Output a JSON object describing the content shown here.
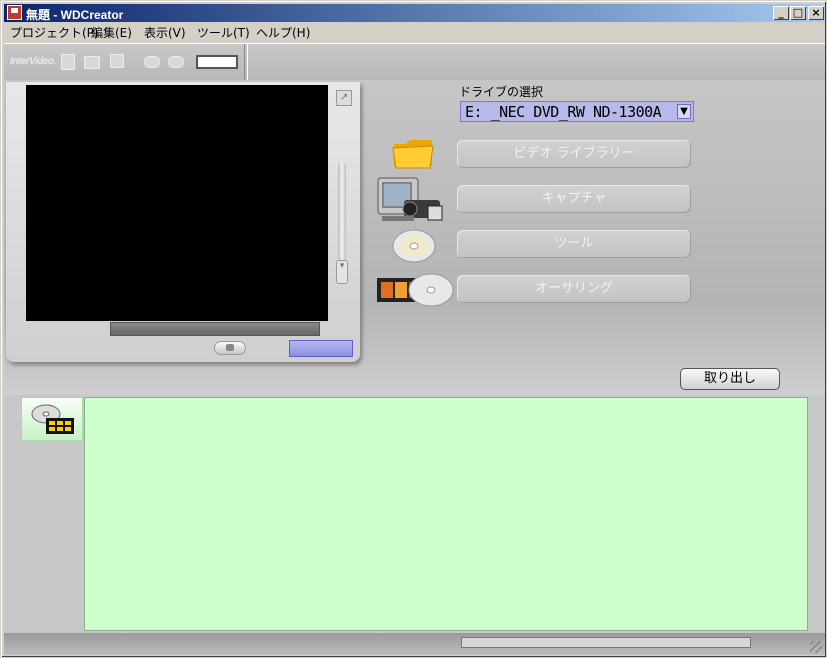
{
  "window": {
    "title": "無題 - WDCreator",
    "minimize": "_",
    "maximize": "□",
    "close": "×"
  },
  "menu": [
    {
      "label": "プロジェクト(P)"
    },
    {
      "label": "編集(E)"
    },
    {
      "label": "表示(V)"
    },
    {
      "label": "ツール(T)"
    },
    {
      "label": "ヘルプ(H)"
    }
  ],
  "toolbar": {
    "logo": "InterVideo."
  },
  "drive": {
    "label": "ドライブの選択",
    "selected": "E: _NEC DVD_RW ND-1300A",
    "arrow": "▼"
  },
  "buttons": {
    "video_library": "ビデオ ライブラリー",
    "capture": "キャプチャ",
    "tools": "ツール",
    "authoring": "オーサリング",
    "eject": "取り出し"
  },
  "colors": {
    "accent_panel": "#ccffcc",
    "title_start": "#0a246a",
    "title_end": "#a6caf0",
    "drive_select": "#b8b8ea"
  },
  "icons": [
    "app-icon",
    "new-file-icon",
    "open-folder-icon",
    "save-icon",
    "undo-icon",
    "redo-icon",
    "timeline-icon",
    "folder-icon",
    "tv-camcorder-icon",
    "disc-icon",
    "film-disc-icon",
    "disc-tab-icon"
  ]
}
